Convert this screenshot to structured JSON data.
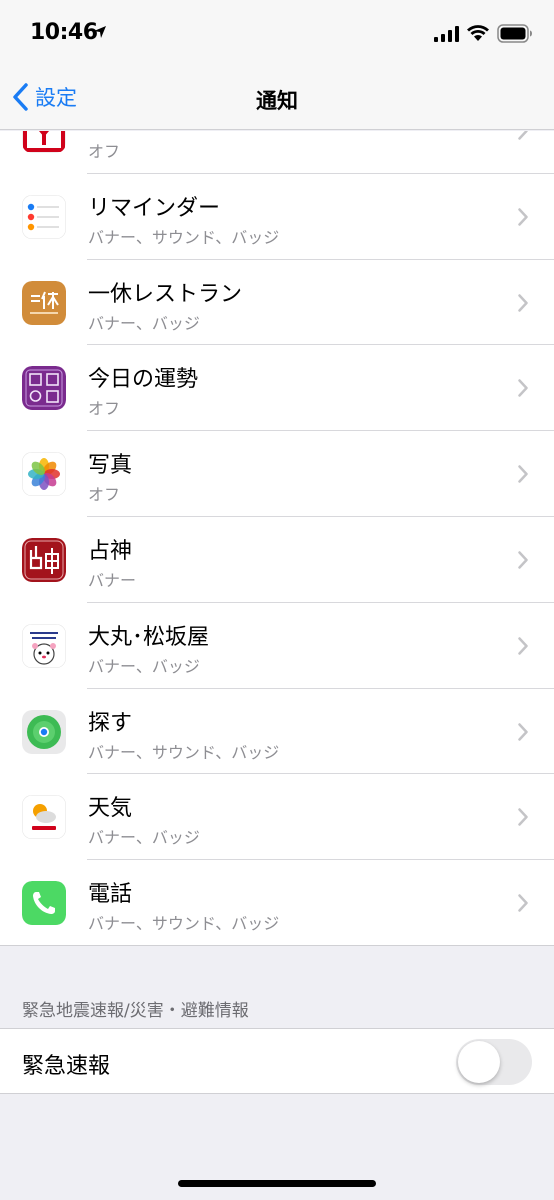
{
  "status_bar": {
    "time": "10:46"
  },
  "nav": {
    "back_label": "設定",
    "title": "通知"
  },
  "partial_row": {
    "subtitle": "オフ"
  },
  "apps": [
    {
      "icon": "reminders-icon",
      "title": "リマインダー",
      "subtitle": "バナー、サウンド、バッジ"
    },
    {
      "icon": "ikyu-restaurant-icon",
      "title": "一休レストラン",
      "subtitle": "バナー、バッジ"
    },
    {
      "icon": "fortune-app-icon",
      "title": "今日の運勢",
      "subtitle": "オフ"
    },
    {
      "icon": "photos-icon",
      "title": "写真",
      "subtitle": "オフ"
    },
    {
      "icon": "uranai-icon",
      "title": "占神",
      "subtitle": "バナー"
    },
    {
      "icon": "daimaru-matsuzakaya-icon",
      "title": "大丸･松坂屋",
      "subtitle": "バナー、バッジ"
    },
    {
      "icon": "find-my-icon",
      "title": "探す",
      "subtitle": "バナー、サウンド、バッジ"
    },
    {
      "icon": "yahoo-weather-icon",
      "title": "天気",
      "subtitle": "バナー、バッジ"
    },
    {
      "icon": "phone-icon",
      "title": "電話",
      "subtitle": "バナー、サウンド、バッジ"
    }
  ],
  "emergency": {
    "section_header": "緊急地震速報/災害・避難情報",
    "label": "緊急速報",
    "enabled": false
  },
  "colors": {
    "accent": "#1a7cf4",
    "secondary_text": "#8e8e93",
    "background": "#efeff4"
  }
}
